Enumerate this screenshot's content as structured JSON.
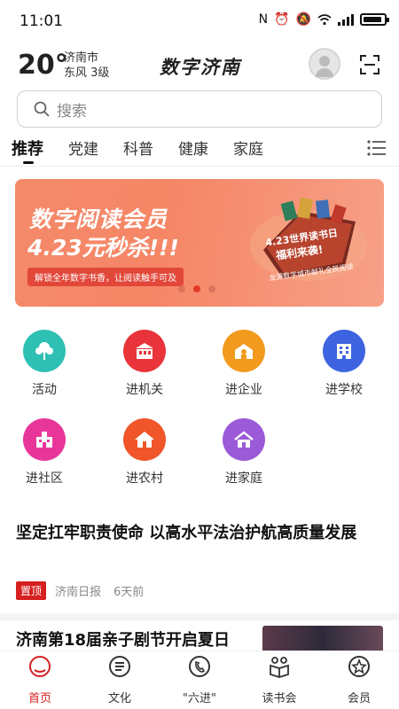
{
  "status_bar": {
    "time": "11:01"
  },
  "header": {
    "temperature": "20°",
    "city": "济南市",
    "wind": "东风  3级",
    "brand": "数字济南"
  },
  "search": {
    "placeholder": "搜索"
  },
  "tabs": [
    {
      "label": "推荐",
      "active": true
    },
    {
      "label": "党建"
    },
    {
      "label": "科普"
    },
    {
      "label": "健康"
    },
    {
      "label": "家庭"
    }
  ],
  "banner": {
    "line1": "数字阅读会员",
    "line2": "4.23元秒杀!!!",
    "subtitle": "解锁全年数字书香，让阅读触手可及",
    "promo_line1": "4.23世界读书日",
    "promo_line2": "福利来袭!",
    "promo_line3": "龙源数字城市献礼全民阅读",
    "active_dot": 1,
    "dot_count": 3
  },
  "grid": [
    {
      "label": "活动",
      "icon": "tree-icon",
      "color": "#2fc0b4"
    },
    {
      "label": "进机关",
      "icon": "building-icon",
      "color": "#e8343a"
    },
    {
      "label": "进企业",
      "icon": "factory-icon",
      "color": "#f29a1e"
    },
    {
      "label": "进学校",
      "icon": "school-icon",
      "color": "#3d63e0"
    },
    {
      "label": "进社区",
      "icon": "community-icon",
      "color": "#e8359a"
    },
    {
      "label": "进农村",
      "icon": "farmhouse-icon",
      "color": "#f0562a"
    },
    {
      "label": "进家庭",
      "icon": "home-icon",
      "color": "#9b5ad8"
    }
  ],
  "news": [
    {
      "title": "坚定扛牢职责使命  以高水平法治护航高质量发展",
      "tag": "置顶",
      "source": "济南日报",
      "time": "6天前"
    },
    {
      "title": "济南第18届亲子剧节开启夏日"
    }
  ],
  "bottom_nav": [
    {
      "label": "首页",
      "icon": "home-nav-icon",
      "active": true
    },
    {
      "label": "文化",
      "icon": "document-icon"
    },
    {
      "label": "\"六进\"",
      "icon": "phone-circle-icon"
    },
    {
      "label": "读书会",
      "icon": "reading-club-icon"
    },
    {
      "label": "会员",
      "icon": "member-star-icon"
    }
  ],
  "colors": {
    "accent": "#d61f1f",
    "banner": "#f58666"
  }
}
